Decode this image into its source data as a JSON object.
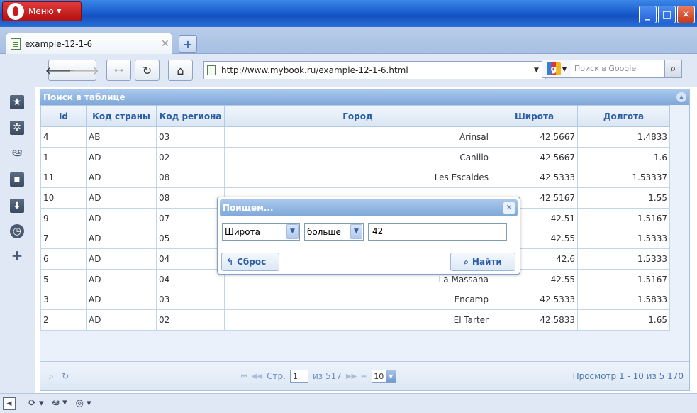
{
  "browser": {
    "menu_label": "Меню",
    "tab_title": "example-12-1-6",
    "url": "http://www.mybook.ru/example-12-1-6.html",
    "search_placeholder": "Поиск в Google"
  },
  "grid": {
    "caption": "Поиск в таблице",
    "columns": [
      "Id",
      "Код страны",
      "Код региона",
      "Город",
      "Широта",
      "Долгота"
    ],
    "rows": [
      [
        "4",
        "AB",
        "03",
        "Arinsal",
        "42.5667",
        "1.4833"
      ],
      [
        "1",
        "AD",
        "02",
        "Canillo",
        "42.5667",
        "1.6"
      ],
      [
        "11",
        "AD",
        "08",
        "Les Escaldes",
        "42.5333",
        "1.53337"
      ],
      [
        "10",
        "AD",
        "08",
        "",
        "42.5167",
        "1.55"
      ],
      [
        "9",
        "AD",
        "07",
        "",
        "42.51",
        "1.5167"
      ],
      [
        "7",
        "AD",
        "05",
        "",
        "42.55",
        "1.5333"
      ],
      [
        "6",
        "AD",
        "04",
        "",
        "42.6",
        "1.5333"
      ],
      [
        "5",
        "AD",
        "04",
        "La Massana",
        "42.55",
        "1.5167"
      ],
      [
        "3",
        "AD",
        "03",
        "Encamp",
        "42.5333",
        "1.5833"
      ],
      [
        "2",
        "AD",
        "02",
        "El Tarter",
        "42.5833",
        "1.65"
      ]
    ],
    "pager": {
      "page_label": "Стр.",
      "page": "1",
      "of_pages": "из 517",
      "rows_per_page": "10",
      "view_text": "Просмотр 1 - 10 из 5 170"
    }
  },
  "dialog": {
    "title": "Поищем...",
    "field": "Широта",
    "operator": "больше",
    "value": "42",
    "reset_label": "Сброс",
    "find_label": "Найти"
  }
}
